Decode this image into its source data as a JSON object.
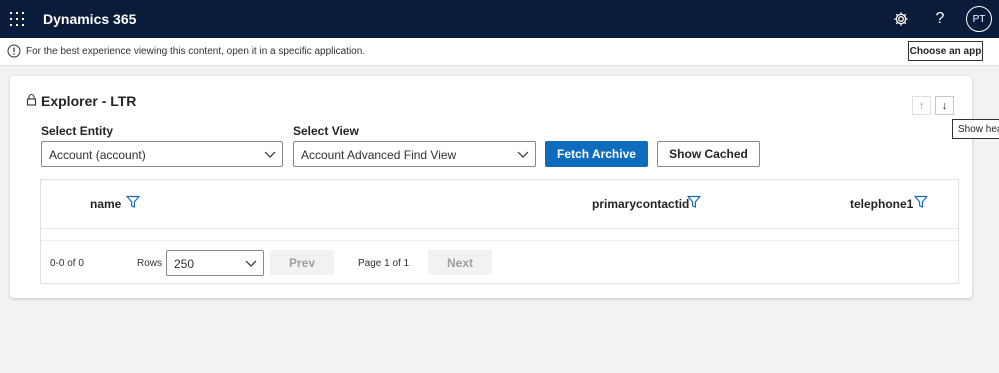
{
  "header": {
    "app_title": "Dynamics 365",
    "avatar_initials": "PT",
    "help_glyph": "?"
  },
  "notice": {
    "text": "For the best experience viewing this content, open it in a specific application.",
    "button_label": "Choose an app"
  },
  "panel": {
    "title": "Explorer - LTR",
    "tooltip": "Show header",
    "sort_up": "↑",
    "sort_down": "↓",
    "entity": {
      "label": "Select Entity",
      "value": "Account (account)"
    },
    "view": {
      "label": "Select View",
      "value": "Account Advanced Find View"
    },
    "fetch_label": "Fetch Archive",
    "cached_label": "Show Cached"
  },
  "table": {
    "columns": [
      "name",
      "primarycontactid",
      "telephone1"
    ]
  },
  "pager": {
    "range": "0-0 of 0",
    "rows_label": "Rows",
    "rows_value": "250",
    "prev_label": "Prev",
    "page_info": "Page 1 of 1",
    "next_label": "Next"
  },
  "icons": {
    "waffle": "app-launcher-icon",
    "settings": "gear-icon",
    "help": "help-icon",
    "info": "info-icon",
    "lock": "lock-icon",
    "filter": "filter-icon",
    "chevron": "chevron-down-icon"
  },
  "colors": {
    "topbar": "#0b1b3a",
    "primary": "#0f6cbd",
    "filter": "#0f6cbd"
  }
}
